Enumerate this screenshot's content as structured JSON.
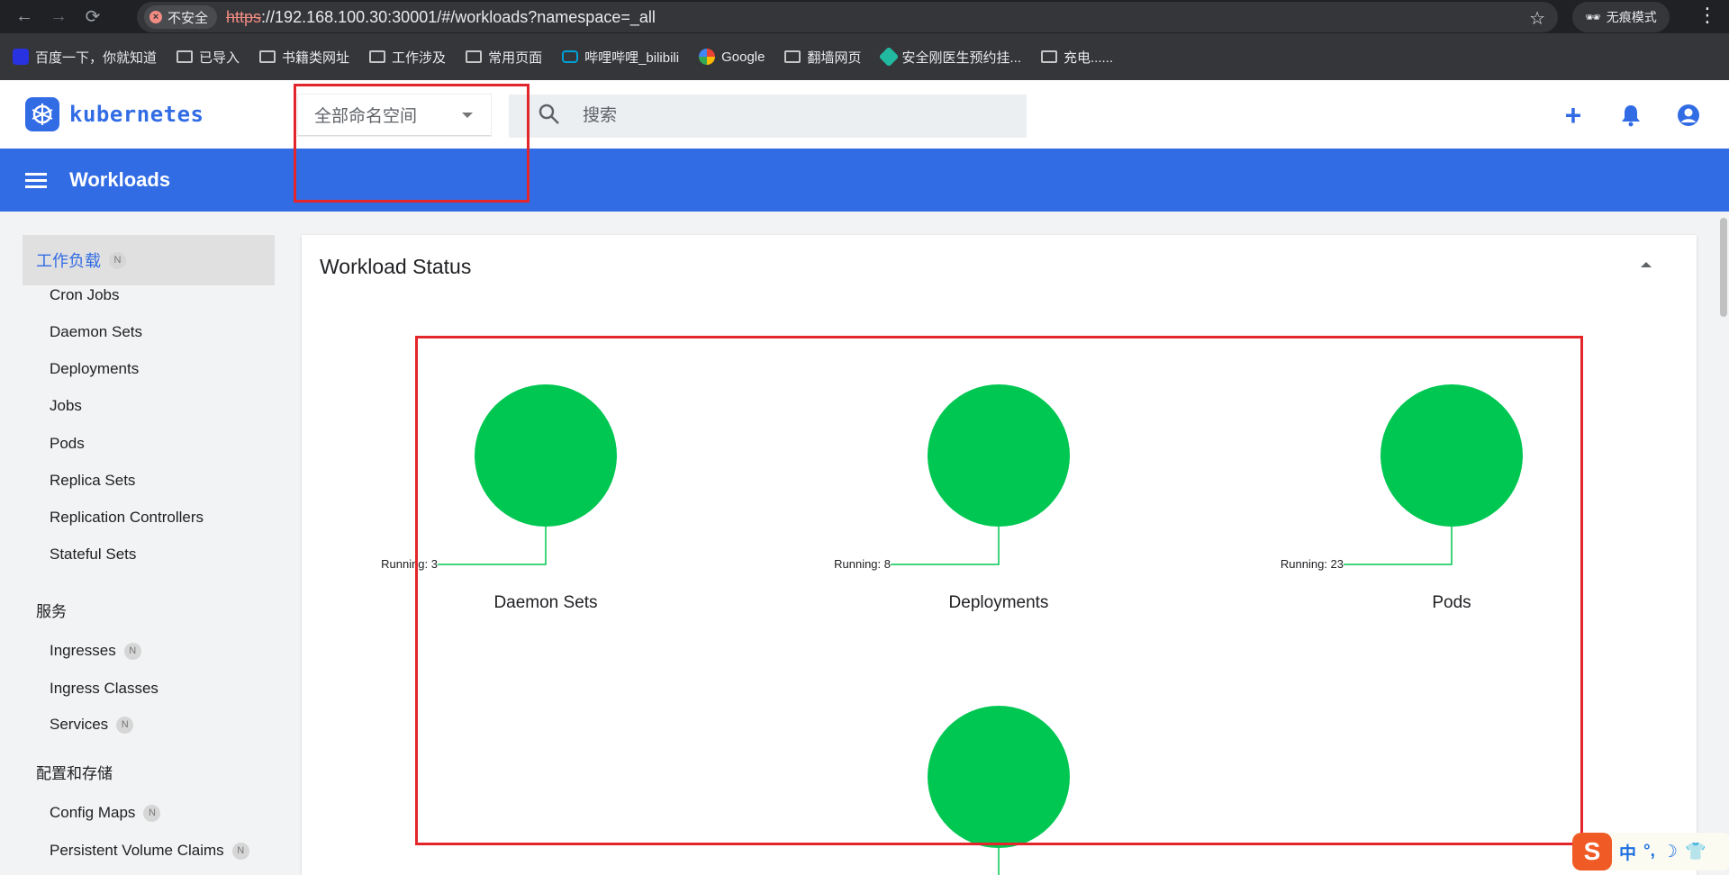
{
  "browser": {
    "security_label": "不安全",
    "url_scheme": "https",
    "url_rest": "://192.168.100.30:30001/#/workloads?namespace=_all",
    "incognito_label": "无痕模式"
  },
  "bookmarks": [
    {
      "label": "百度一下，你就知道",
      "icon": "baidu-icon"
    },
    {
      "label": "已导入",
      "icon": "folder-icon"
    },
    {
      "label": "书籍类网址",
      "icon": "folder-icon"
    },
    {
      "label": "工作涉及",
      "icon": "folder-icon"
    },
    {
      "label": "常用页面",
      "icon": "folder-icon"
    },
    {
      "label": "哔哩哔哩_bilibili",
      "icon": "bilibili-icon"
    },
    {
      "label": "Google",
      "icon": "google-icon"
    },
    {
      "label": "翻墙网页",
      "icon": "folder-icon"
    },
    {
      "label": "安全刚医生预约挂...",
      "icon": "medical-icon"
    },
    {
      "label": "充电......",
      "icon": "folder-icon"
    }
  ],
  "header": {
    "logo_text": "kubernetes",
    "namespace_selected": "全部命名空间",
    "search_placeholder": "搜索"
  },
  "toolbar": {
    "title": "Workloads"
  },
  "sidebar": {
    "workloads_label": "工作负载",
    "workloads_badge": "N",
    "workload_items": [
      "Cron Jobs",
      "Daemon Sets",
      "Deployments",
      "Jobs",
      "Pods",
      "Replica Sets",
      "Replication Controllers",
      "Stateful Sets"
    ],
    "services_heading": "服务",
    "ingresses_label": "Ingresses",
    "ingresses_badge": "N",
    "ingress_classes_label": "Ingress Classes",
    "services_label": "Services",
    "services_badge": "N",
    "config_heading": "配置和存储",
    "config_maps_label": "Config Maps",
    "config_maps_badge": "N",
    "pvc_label": "Persistent Volume Claims",
    "pvc_badge": "N"
  },
  "main": {
    "card_title": "Workload Status"
  },
  "chart_data": {
    "type": "pie",
    "colors": {
      "running": "#00c752"
    },
    "charts": [
      {
        "name": "Daemon Sets",
        "label": "Running: 3",
        "running": 3
      },
      {
        "name": "Deployments",
        "label": "Running: 8",
        "running": 8
      },
      {
        "name": "Pods",
        "label": "Running: 23",
        "running": 23
      },
      {
        "name": "",
        "label": "",
        "running": null
      }
    ]
  },
  "ime": {
    "logo": "S",
    "mode": "中"
  }
}
